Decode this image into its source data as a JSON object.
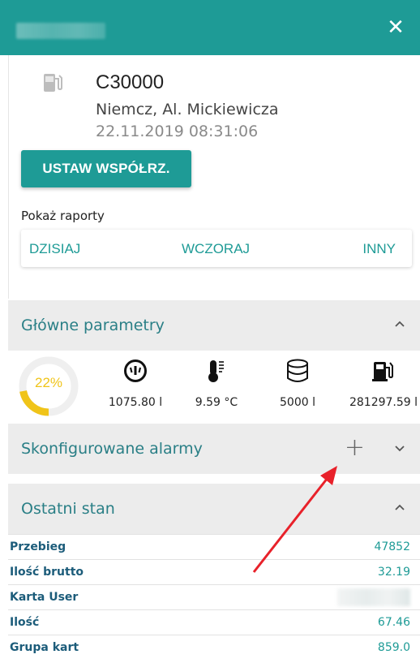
{
  "header": {
    "title_hidden": true,
    "close_icon": "close-icon"
  },
  "device": {
    "icon": "fuel-pump-icon",
    "name": "C30000",
    "address": "Niemcz, Al. Mickiewicza",
    "datetime": "22.11.2019 08:31:06"
  },
  "actions": {
    "set_coords_label": "USTAW WSPÓŁRZ."
  },
  "reports": {
    "label": "Pokaż raporty",
    "today": "DZISIAJ",
    "yesterday": "WCZORAJ",
    "other": "INNY"
  },
  "main_params": {
    "title": "Główne parametry",
    "gauge": {
      "label": "22%",
      "value": 0.22,
      "color": "#f0c419",
      "track": "#efefef"
    },
    "items": [
      {
        "icon": "meter-icon",
        "value": "1075.80 l"
      },
      {
        "icon": "thermometer-icon",
        "value": "9.59 °C"
      },
      {
        "icon": "database-icon",
        "value": "5000 l"
      },
      {
        "icon": "fuel-pump-icon",
        "value": "281297.59 l"
      }
    ]
  },
  "alarms": {
    "title": "Skonfigurowane alarmy",
    "add_icon": "plus-icon",
    "toggle_icon": "chevron-down-icon"
  },
  "last_state": {
    "title": "Ostatni stan",
    "rows": [
      {
        "key": "Przebieg",
        "value": "47852"
      },
      {
        "key": "Ilość brutto",
        "value": "32.19"
      },
      {
        "key": "Karta User",
        "value": ""
      },
      {
        "key": "Ilość",
        "value": "67.46"
      },
      {
        "key": "Grupa kart",
        "value": "859.0"
      }
    ]
  },
  "colors": {
    "accent": "#1e9b96",
    "header": "#1e9b96",
    "section_bg": "#ececec",
    "annotation_arrow": "#e8212a"
  }
}
